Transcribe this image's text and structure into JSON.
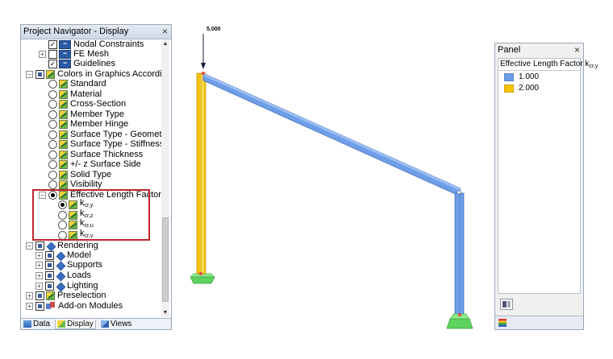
{
  "navigator": {
    "title": "Project Navigator - Display",
    "close_glyph": "×",
    "items": [
      {
        "label": "Nodal Constraints",
        "check": "checked",
        "icon": "nav-icon",
        "expander": "none"
      },
      {
        "label": "FE Mesh",
        "check": "unchecked",
        "icon": "nav-icon",
        "expander": "plus"
      },
      {
        "label": "Guidelines",
        "check": "checked",
        "icon": "nav-icon",
        "expander": "none"
      },
      {
        "label": "Colors in Graphics According to",
        "check": "partial",
        "icon": "color-icon",
        "expander": "minus"
      },
      {
        "label": "Standard",
        "radio": false
      },
      {
        "label": "Material",
        "radio": false
      },
      {
        "label": "Cross-Section",
        "radio": false
      },
      {
        "label": "Member Type",
        "radio": false
      },
      {
        "label": "Member Hinge",
        "radio": false
      },
      {
        "label": "Surface Type - Geometry",
        "radio": false
      },
      {
        "label": "Surface Type - Stiffness",
        "radio": false
      },
      {
        "label": "Surface Thickness",
        "radio": false
      },
      {
        "label": "+/- z Surface Side",
        "radio": false
      },
      {
        "label": "Solid Type",
        "radio": false
      },
      {
        "label": "Visibility",
        "radio": false
      },
      {
        "label": "Effective Length Factor",
        "radio": true
      },
      {
        "label": "k",
        "sub": "cr,y",
        "radio": true
      },
      {
        "label": "k",
        "sub": "cr,z",
        "radio": false
      },
      {
        "label": "k",
        "sub": "cr,u",
        "radio": false
      },
      {
        "label": "k",
        "sub": "cr,v",
        "radio": false
      },
      {
        "label": "Rendering",
        "check": "partial",
        "icon": "render-icon",
        "expander": "minus"
      },
      {
        "label": "Model",
        "check": "partial",
        "icon": "render-icon",
        "expander": "plus"
      },
      {
        "label": "Supports",
        "check": "partial",
        "icon": "render-icon",
        "expander": "plus"
      },
      {
        "label": "Loads",
        "check": "partial",
        "icon": "render-icon",
        "expander": "plus"
      },
      {
        "label": "Lighting",
        "check": "partial",
        "icon": "render-icon",
        "expander": "plus"
      },
      {
        "label": "Preselection",
        "check": "partial",
        "icon": "color-icon",
        "expander": "plus"
      },
      {
        "label": "Add-on Modules",
        "check": "partial",
        "icon": "addon-icon",
        "expander": "plus"
      }
    ],
    "tabs": [
      {
        "label": "Data",
        "icon": "data"
      },
      {
        "label": "Display",
        "icon": "display"
      },
      {
        "label": "Views",
        "icon": "views"
      }
    ]
  },
  "viewport": {
    "load_label": "5.000",
    "colors": {
      "factor_1": "#6f9ee8",
      "factor_2": "#f5c400",
      "support": "#5fd35f"
    }
  },
  "panel": {
    "title": "Panel",
    "close_glyph": "×",
    "legend_title": "Effective Length Factor k",
    "legend_title_sub": "cr,y",
    "legend": [
      {
        "label": "1.000",
        "color": "#6f9ee8"
      },
      {
        "label": "2.000",
        "color": "#f5c400"
      }
    ]
  }
}
